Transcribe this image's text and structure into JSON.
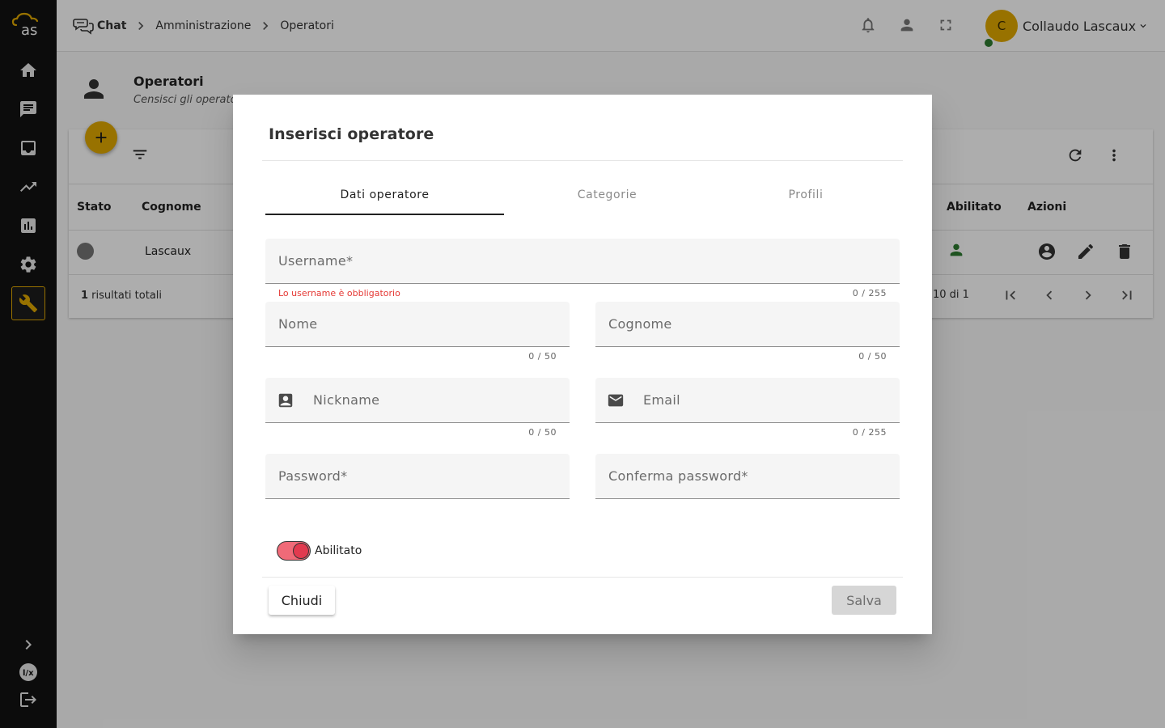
{
  "header": {
    "breadcrumb": [
      "Chat",
      "Amministrazione",
      "Operatori"
    ],
    "user_initial": "C",
    "user_name": "Collaudo Lascaux"
  },
  "sidebar": {
    "items": [
      "home-icon",
      "chat-icon",
      "inbox-icon",
      "trending-icon",
      "bar-chart-icon",
      "settings-icon",
      "wrench-icon"
    ],
    "bottom": [
      "chevron-right-icon",
      "brand-icon",
      "logout-icon"
    ],
    "accent": "#e0a800"
  },
  "page": {
    "title": "Operatori",
    "subtitle": "Censisci gli operato"
  },
  "table": {
    "columns": {
      "stato": "Stato",
      "cognome": "Cognome",
      "abilitato": "Abilitato",
      "azioni": "Azioni"
    },
    "rows": [
      {
        "cognome": "Lascaux",
        "abilitato": true
      }
    ],
    "total_count": "1",
    "total_label": " risultati totali",
    "page_range": "10 di 1"
  },
  "dialog": {
    "title": "Inserisci operatore",
    "tabs": [
      "Dati operatore",
      "Categorie",
      "Profili"
    ],
    "active_tab": 0,
    "fields": {
      "username": {
        "label": "Username*",
        "counter": "0 / 255",
        "error": "Lo username è obbligatorio"
      },
      "nome": {
        "label": "Nome",
        "counter": "0 / 50"
      },
      "cognome": {
        "label": "Cognome",
        "counter": "0 / 50"
      },
      "nickname": {
        "label": "Nickname",
        "counter": "0 / 50"
      },
      "email": {
        "label": "Email",
        "counter": "0 / 255"
      },
      "password": {
        "label": "Password*"
      },
      "confirm_password": {
        "label": "Conferma password*"
      }
    },
    "toggle": {
      "label": "Abilitato",
      "on": true
    },
    "close_label": "Chiudi",
    "save_label": "Salva"
  }
}
